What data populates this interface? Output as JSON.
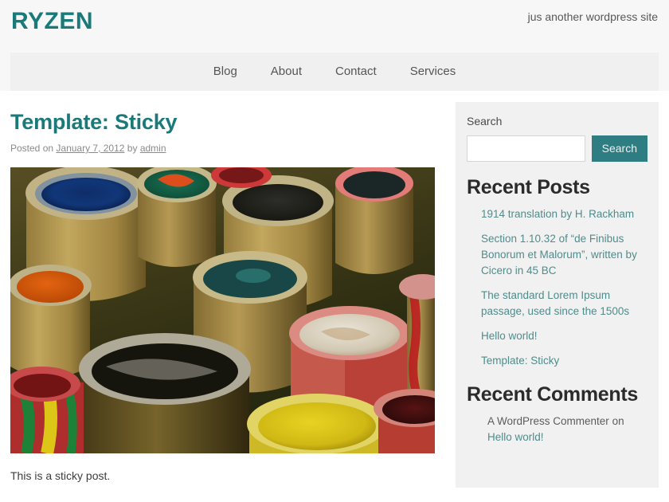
{
  "site": {
    "title": "RYZEN",
    "tagline": "jus another wordpress site",
    "accent_color": "#1a7a7a",
    "link_color": "#4f8c8c",
    "button_color": "#2e7d82",
    "header_bg": "#f7f7f7",
    "nav_bg": "#f0f0f0",
    "sidebar_bg": "#f1f1f1"
  },
  "nav": {
    "items": [
      {
        "label": "Blog"
      },
      {
        "label": "About"
      },
      {
        "label": "Contact"
      },
      {
        "label": "Services"
      }
    ]
  },
  "post": {
    "title": "Template: Sticky",
    "meta_posted_on": "Posted on",
    "meta_date": "January 7, 2012",
    "meta_by": "by",
    "meta_author": "admin",
    "featured_image_alt": "bamboo tubes filled with colored pigment powders",
    "body": "This is a sticky post."
  },
  "sidebar": {
    "search": {
      "title": "Search",
      "value": "",
      "placeholder": "",
      "button_label": "Search"
    },
    "recent_posts": {
      "title": "Recent Posts",
      "items": [
        {
          "label": "1914 translation by H. Rackham"
        },
        {
          "label": "Section 1.10.32 of “de Finibus Bonorum et Malorum”, written by Cicero in 45 BC"
        },
        {
          "label": "The standard Lorem Ipsum passage, used since the 1500s"
        },
        {
          "label": "Hello world!"
        },
        {
          "label": "Template: Sticky"
        }
      ]
    },
    "recent_comments": {
      "title": "Recent Comments",
      "items": [
        {
          "author": "A WordPress Commenter",
          "on": "on",
          "post": "Hello world!"
        }
      ]
    }
  }
}
